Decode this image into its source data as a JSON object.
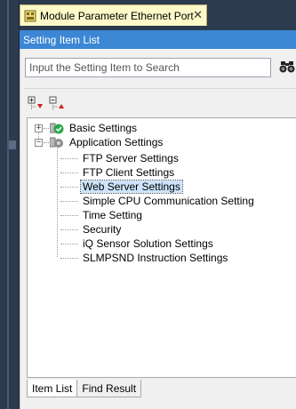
{
  "window_tab": {
    "title": "Module Parameter Ethernet Port",
    "close_glyph": "✕"
  },
  "panel": {
    "title": "Setting Item List"
  },
  "search": {
    "placeholder": "Input the Setting Item to Search",
    "value": ""
  },
  "toolbar": {
    "expand_all_icon": "expand-all-icon",
    "collapse_all_icon": "collapse-all-icon"
  },
  "tree": {
    "nodes": [
      {
        "label": "Basic Settings",
        "expander": "+",
        "status_icon": "check-icon"
      },
      {
        "label": "Application Settings",
        "expander": "−",
        "status_icon": "gear-icon",
        "children": [
          {
            "label": "FTP Server Settings"
          },
          {
            "label": "FTP Client Settings"
          },
          {
            "label": "Web Server Settings",
            "selected": true
          },
          {
            "label": "Simple CPU Communication Setting"
          },
          {
            "label": "Time Setting"
          },
          {
            "label": "Security"
          },
          {
            "label": "iQ Sensor Solution Settings"
          },
          {
            "label": "SLMPSND Instruction Settings"
          }
        ]
      }
    ]
  },
  "bottom_tabs": [
    {
      "label": "Item List",
      "active": true
    },
    {
      "label": "Find Result",
      "active": false
    }
  ],
  "colors": {
    "panel_header": "#3c87d4",
    "doc_tab": "#fff8c8",
    "ide_frame": "#2b3a4d",
    "status_ok": "#2aa84a"
  }
}
